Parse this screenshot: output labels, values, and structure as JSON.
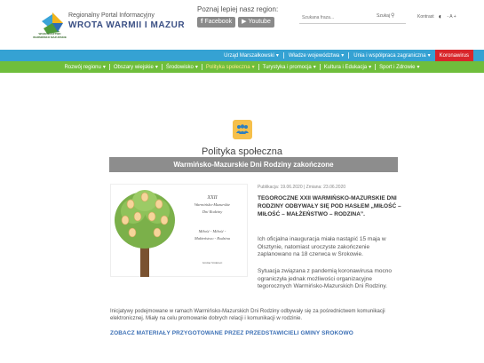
{
  "header": {
    "logo_sub": "WOJEWÓDZTWO WARMIŃSKO MAZURSKIE",
    "portal_sub": "Regionalny Portal Informacyjny",
    "portal_title": "WROTA WARMII I MAZUR",
    "region_label": "Poznaj lepiej nasz region:",
    "facebook_label": "Facebook",
    "youtube_label": "Youtube",
    "search_placeholder": "Szukana fraza...",
    "search_button": "Szukaj",
    "contrast_label": "Kontrast",
    "font_size_label": "- A +"
  },
  "nav_top": {
    "items": [
      "Urząd Marszałkowski",
      "Władze województwa",
      "Unia i współpraca zagraniczna",
      "Koronawirus"
    ]
  },
  "nav_green": {
    "items": [
      "Rozwój regionu",
      "Obszary wiejskie",
      "Środowisko",
      "Polityka społeczna",
      "Turystyka i promocja",
      "Kultura i Edukacja",
      "Sport i Zdrowie"
    ],
    "active_index": 3
  },
  "category": {
    "title": "Polityka społeczna"
  },
  "article": {
    "title": "Warmińsko-Mazurskie Dni Rodziny zakończone",
    "pub_date": "Publikacja: 19.06.2020 | Zmiana: 23.06.2020",
    "lead": "TEGOROCZNE XXII WARMIŃSKO-MAZURSKIE DNI RODZINY ODBYWAŁY SIĘ POD HASŁEM „MIŁOŚĆ – MIŁOŚĆ – MAŁŻEŃSTWO – RODZINA”.",
    "para1": "Ich oficjalna inauguracja miała nastąpić 15 maja w Olsztynie, natomiast uroczyste zakończenie zaplanowano na 18 czerwca w Srokowie.",
    "para2": "Sytuacja związana z pandemią koronawirusa mocno ograniczyła jednak możliwości organizacyjne tegorocznych Warmińsko-Mazurskich Dni Rodziny.",
    "para3": "Inicjatywy podejmowane w ramach Warmińsko-Mazurskich Dni Rodziny odbywały się za pośrednictwem komunikacji elektronicznej. Miały na celu promowanie dobrych relacji i komunikacji w rodzinie.",
    "more_link": "ZOBACZ MATERIAŁY PRZYGOTOWANE PRZEZ PRZEDSTAWICIELI GMINY SROKOWO"
  },
  "poster": {
    "line1": "XXII",
    "line2": "Warmińsko-Mazurskie",
    "line3": "Dni Rodziny",
    "line4": "Miłość - Miłość -",
    "line5": "Małżeństwo - Rodzina",
    "line6": "Gmina Srokowo"
  },
  "colors": {
    "blue_bar": "#35a2d3",
    "green_bar": "#6fbe3c",
    "red_item": "#d9262b",
    "article_bar": "#8d8d8d",
    "category_icon": "#f6c04b",
    "link": "#3b6fb5"
  }
}
